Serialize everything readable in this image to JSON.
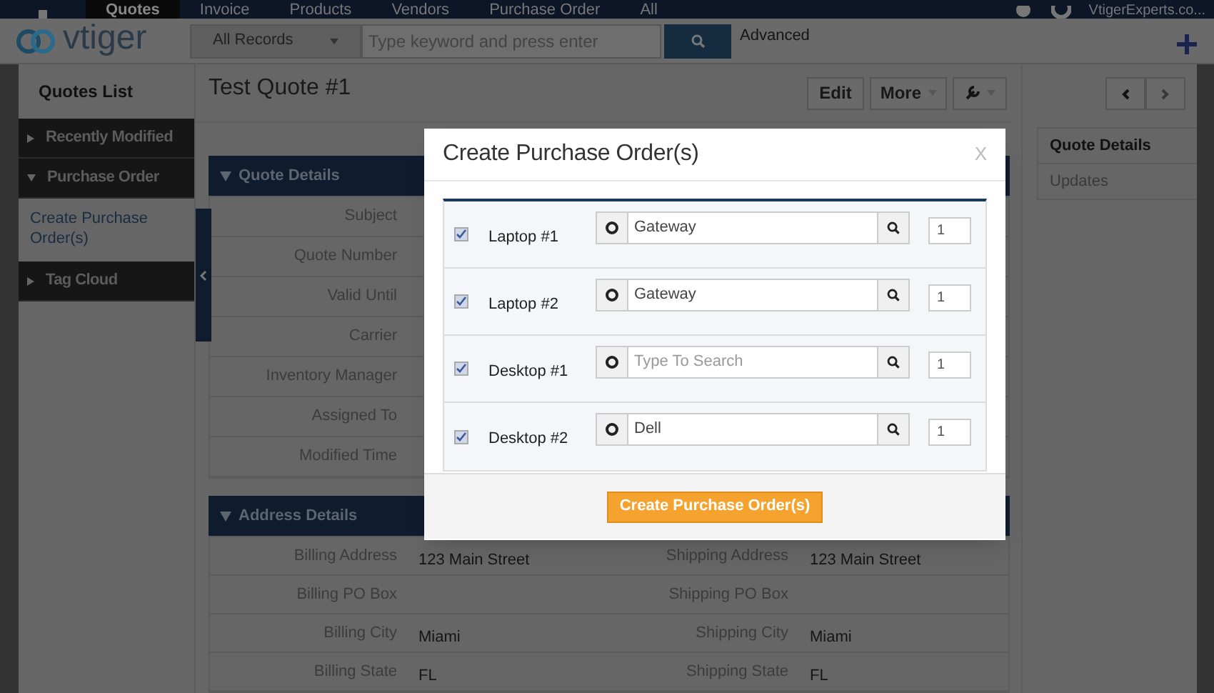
{
  "top_nav": {
    "tabs": [
      {
        "label": "Quotes",
        "selected": true
      },
      {
        "label": "Invoice",
        "selected": false
      },
      {
        "label": "Products",
        "selected": false
      },
      {
        "label": "Vendors",
        "selected": false
      },
      {
        "label": "Purchase Order",
        "selected": false
      },
      {
        "label": "All",
        "selected": false
      }
    ],
    "user": "VtigerExperts.co..."
  },
  "logo": "vtiger",
  "search": {
    "scope": "All Records",
    "placeholder": "Type keyword and press enter",
    "advanced": "Advanced"
  },
  "sidebar": {
    "title": "Quotes List",
    "sections": [
      {
        "label": "Recently Modified",
        "expanded": false
      },
      {
        "label": "Purchase Order",
        "expanded": true,
        "children": [
          {
            "label": "Create Purchase Order(s)"
          }
        ]
      },
      {
        "label": "Tag Cloud",
        "expanded": false
      }
    ]
  },
  "record": {
    "title": "Test Quote #1",
    "buttons": [
      "Edit",
      "More"
    ]
  },
  "quote_details": {
    "title": "Quote Details",
    "rows": [
      {
        "label": "Subject",
        "value": ""
      },
      {
        "label": "Quote Number",
        "value": ""
      },
      {
        "label": "Valid Until",
        "value": ""
      },
      {
        "label": "Carrier",
        "value": ""
      },
      {
        "label": "Inventory Manager",
        "value": ""
      },
      {
        "label": "Assigned To",
        "value": ""
      },
      {
        "label": "Modified Time",
        "value": ""
      }
    ]
  },
  "address_details": {
    "title": "Address Details",
    "rows": [
      {
        "label": "Billing Address",
        "value": "123 Main Street",
        "label_2": "Shipping Address",
        "value_2": "123 Main Street"
      },
      {
        "label": "Billing PO Box",
        "value": "",
        "label_2": "Shipping PO Box",
        "value_2": ""
      },
      {
        "label": "Billing City",
        "value": "Miami",
        "label_2": "Shipping City",
        "value_2": "Miami"
      },
      {
        "label": "Billing State",
        "value": "FL",
        "label_2": "Shipping State",
        "value_2": "FL"
      }
    ]
  },
  "right_tabs": [
    {
      "label": "Quote Details",
      "selected": true
    },
    {
      "label": "Updates",
      "selected": false
    }
  ],
  "modal": {
    "title": "Create Purchase Order(s)",
    "close": "X",
    "items": [
      {
        "checked": true,
        "name": "Laptop #1",
        "vendor": "Gateway",
        "quantity": "1"
      },
      {
        "checked": true,
        "name": "Laptop #2",
        "vendor": "Gateway",
        "quantity": "1"
      },
      {
        "checked": true,
        "name": "Desktop #1",
        "placeholder": "Type To Search",
        "quantity": "1"
      },
      {
        "checked": true,
        "name": "Desktop #2",
        "vendor": "Dell",
        "quantity": "1"
      }
    ],
    "submit": "Create Purchase Order(s)"
  }
}
